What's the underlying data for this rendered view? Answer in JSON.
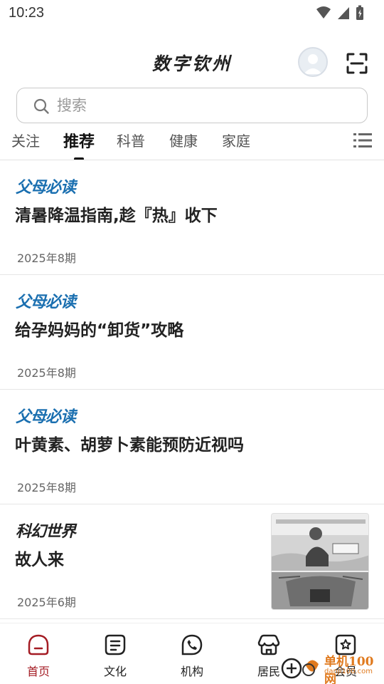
{
  "status_bar": {
    "time": "10:23"
  },
  "header": {
    "title": "数字钦州"
  },
  "search": {
    "placeholder": "搜索"
  },
  "tabs": [
    {
      "label": "关注",
      "active": false
    },
    {
      "label": "推荐",
      "active": true
    },
    {
      "label": "科普",
      "active": false
    },
    {
      "label": "健康",
      "active": false
    },
    {
      "label": "家庭",
      "active": false
    }
  ],
  "articles": [
    {
      "source": "父母必读",
      "title": "清暑降温指南,趁『热』收下",
      "date": "2025年8期",
      "has_image": false
    },
    {
      "source": "父母必读",
      "title": "给孕妈妈的“卸货”攻略",
      "date": "2025年8期",
      "has_image": false
    },
    {
      "source": "父母必读",
      "title": "叶黄素、胡萝卜素能预防近视吗",
      "date": "2025年8期",
      "has_image": false
    },
    {
      "source": "科幻世界",
      "title": "故人来",
      "date": "2025年6期",
      "has_image": true
    }
  ],
  "bottom_nav": [
    {
      "label": "首页",
      "icon": "home-icon",
      "active": true
    },
    {
      "label": "文化",
      "icon": "culture-icon",
      "active": false
    },
    {
      "label": "机构",
      "icon": "phone-icon",
      "active": false
    },
    {
      "label": "居民",
      "icon": "store-icon",
      "active": false
    },
    {
      "label": "会员",
      "icon": "member-icon",
      "active": false
    }
  ],
  "watermark": {
    "text": "单机100网",
    "sub": "danji100.com"
  },
  "colors": {
    "accent": "#a41c24",
    "source_blue": "#1a6fb0",
    "watermark": "#e07a1e"
  }
}
